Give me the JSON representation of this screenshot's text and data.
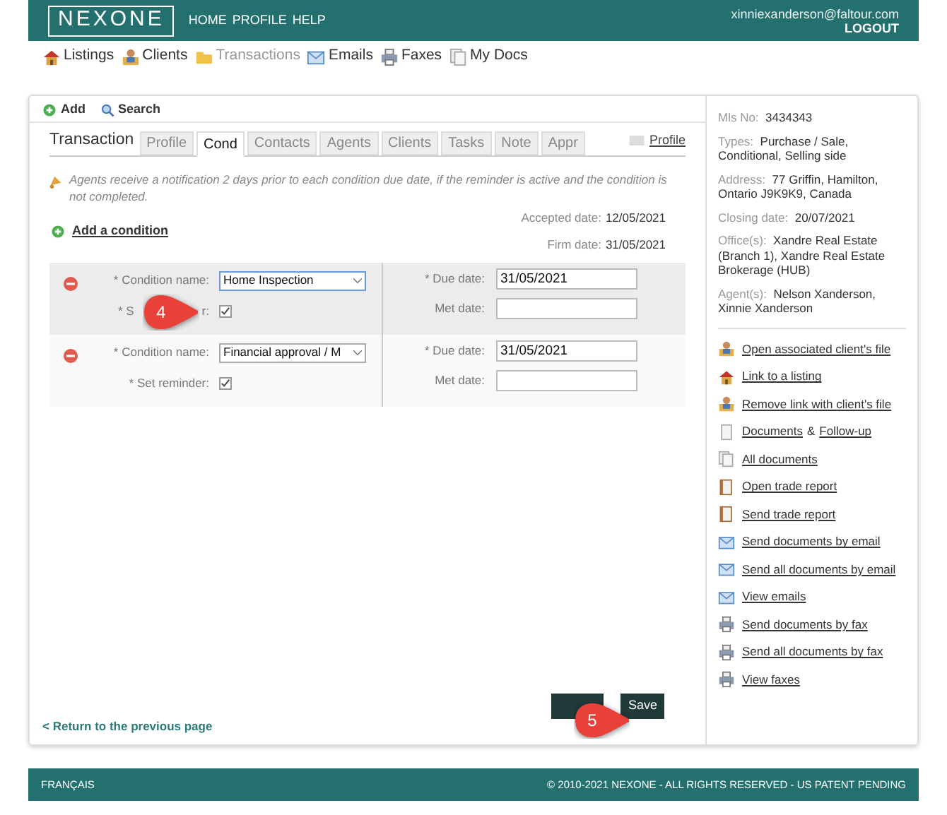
{
  "header": {
    "logo": "NEXONE",
    "menu": [
      "HOME",
      "PROFILE",
      "HELP"
    ],
    "user_email": "xinniexanderson@faltour.com",
    "logout": "LOGOUT"
  },
  "nav": [
    {
      "label": "Listings",
      "selected": false
    },
    {
      "label": "Clients",
      "selected": false
    },
    {
      "label": "Transactions",
      "selected": true
    },
    {
      "label": "Emails",
      "selected": false
    },
    {
      "label": "Faxes",
      "selected": false
    },
    {
      "label": "My Docs",
      "selected": false
    }
  ],
  "toolbar": [
    "Add",
    "Search"
  ],
  "tabs_title": "Transaction",
  "tabs": [
    {
      "label": "Profile",
      "selected": false
    },
    {
      "label": "Cond",
      "selected": true
    },
    {
      "label": "Contacts",
      "selected": false
    },
    {
      "label": "Agents",
      "selected": false
    },
    {
      "label": "Clients",
      "selected": false
    },
    {
      "label": "Tasks",
      "selected": false
    },
    {
      "label": "Note",
      "selected": false
    },
    {
      "label": "Appr",
      "selected": false
    }
  ],
  "profile_link": "Profile",
  "notice": "Agents receive a notification 2 days prior to each condition due date, if the reminder is active and the condition is not completed.",
  "add_condition": "Add a condition",
  "dates": [
    {
      "label": "Accepted date:",
      "value": "12/05/2021"
    },
    {
      "label": "Firm date:",
      "value": "31/05/2021"
    }
  ],
  "conditions": [
    {
      "name_label": "* Condition name:",
      "name": "Home Inspection",
      "reminder_label": [
        "* S",
        "r:"
      ],
      "reminder": true,
      "due_label": "* Due date:",
      "due": "31/05/2021",
      "met_label": "Met date:",
      "highlighted": true
    },
    {
      "name_label": "* Condition name:",
      "name": "Financial approval / M",
      "reminder_label": [
        "* Set reminder:"
      ],
      "reminder": true,
      "due_label": "* Due date:",
      "due": "31/05/2021",
      "met_label": "Met date:",
      "highlighted": false
    }
  ],
  "save": "Save",
  "return_link": "< Return to the previous page",
  "callouts": [
    "4",
    "5"
  ],
  "details": [
    {
      "label": "Mls No:",
      "value": "3434343"
    },
    {
      "label": "Types:",
      "value": "Purchase / Sale, Conditional, Selling side"
    },
    {
      "label": "Address:",
      "value": "77 Griffin, Hamilton, Ontario J9K9K9, Canada"
    },
    {
      "label": "Closing date:",
      "value": "20/07/2021"
    },
    {
      "label": "Office(s):",
      "value": "Xandre Real Estate (Branch 1), Xandre Real Estate Brokerage (HUB)"
    },
    {
      "label": "Agent(s):",
      "value": "Nelson Xanderson, Xinnie Xanderson"
    }
  ],
  "actions": [
    {
      "label": "Open associated client's file"
    },
    {
      "label": "Link to a listing"
    },
    {
      "label": "Remove link with client's file"
    },
    {
      "label": "Documents",
      "label2": "Follow-up",
      "joiner": "&"
    },
    {
      "label": "All documents"
    },
    {
      "label": "Open trade report"
    },
    {
      "label": "Send trade report"
    },
    {
      "label": "Send documents by email"
    },
    {
      "label": "Send all documents by email"
    },
    {
      "label": "View emails"
    },
    {
      "label": "Send documents by fax"
    },
    {
      "label": "Send all documents by fax"
    },
    {
      "label": "View faxes"
    }
  ],
  "footer": {
    "language": "FRANÇAIS",
    "copyright": "© 2010-2021 NEXONE - ALL RIGHTS RESERVED - US PATENT PENDING"
  }
}
